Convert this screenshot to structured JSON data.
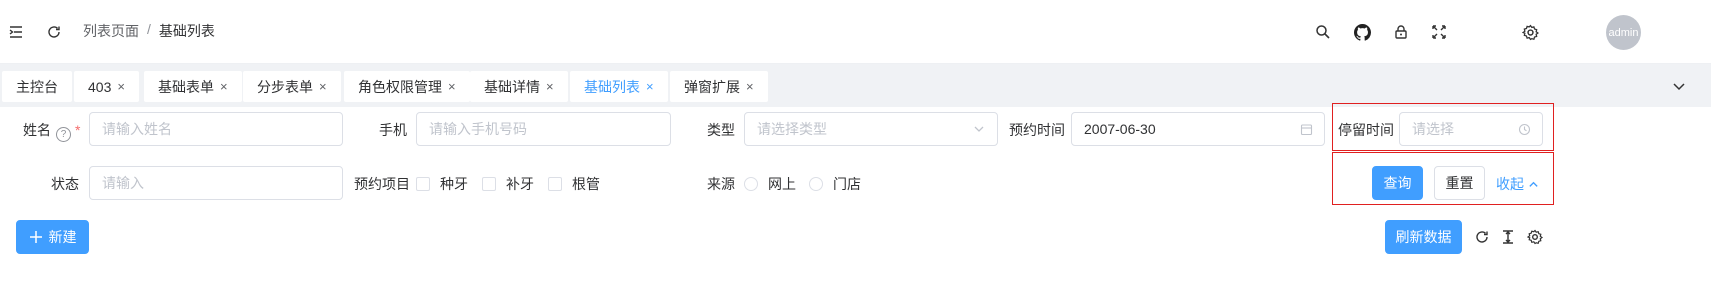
{
  "header": {
    "breadcrumb": [
      "列表页面",
      "基础列表"
    ],
    "breadcrumb_separator": "/",
    "avatar_label": "admin",
    "icons": [
      "menu-fold-icon",
      "refresh-icon",
      "search-icon",
      "github-icon",
      "lock-icon",
      "fullscreen-icon",
      "settings-icon"
    ]
  },
  "tabs": [
    {
      "label": "主控台",
      "closable": false
    },
    {
      "label": "403",
      "closable": true
    },
    {
      "label": "基础表单",
      "closable": true
    },
    {
      "label": "分步表单",
      "closable": true
    },
    {
      "label": "角色权限管理",
      "closable": true
    },
    {
      "label": "基础详情",
      "closable": true
    },
    {
      "label": "基础列表",
      "closable": true,
      "active": true
    },
    {
      "label": "弹窗扩展",
      "closable": true
    }
  ],
  "tab_close_glyph": "×",
  "form": {
    "name": {
      "label": "姓名",
      "required_mark": "*",
      "help_glyph": "?",
      "placeholder": "请输入姓名"
    },
    "phone": {
      "label": "手机",
      "placeholder": "请输入手机号码"
    },
    "type": {
      "label": "类型",
      "placeholder": "请选择类型"
    },
    "booking_time": {
      "label": "预约时间",
      "value": "2007-06-30"
    },
    "stay_time": {
      "label": "停留时间",
      "placeholder": "请选择"
    },
    "status": {
      "label": "状态",
      "placeholder": "请输入"
    },
    "booking_items": {
      "label": "预约项目",
      "options": [
        "种牙",
        "补牙",
        "根管"
      ]
    },
    "source": {
      "label": "来源",
      "options": [
        "网上",
        "门店"
      ]
    }
  },
  "actions": {
    "query": "查询",
    "reset": "重置",
    "collapse": "收起",
    "new": "新建",
    "refresh_data": "刷新数据"
  },
  "colors": {
    "primary": "#409eff",
    "highlight_box": "#e02020"
  }
}
